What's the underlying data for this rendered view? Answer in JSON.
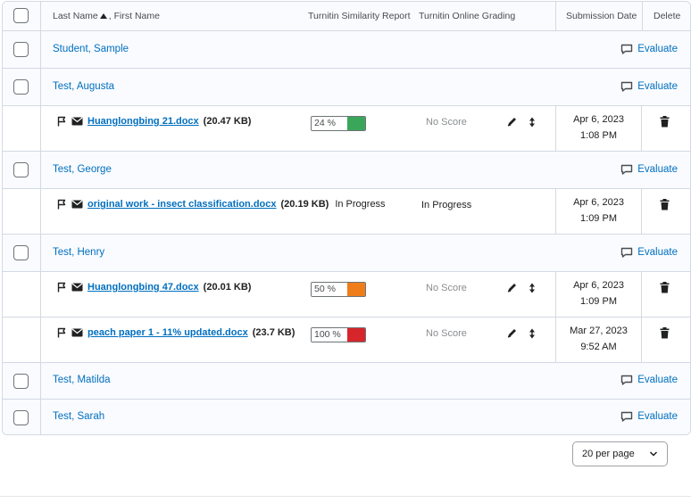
{
  "header": {
    "name_col": "Last Name",
    "name_col_suffix": ", First Name",
    "similarity_col": "Turnitin Similarity Report",
    "grading_col": "Turnitin Online Grading",
    "date_col": "Submission Date",
    "delete_col": "Delete"
  },
  "evaluate_label": "Evaluate",
  "no_score": "No Score",
  "students": [
    {
      "name": "Student, Sample"
    },
    {
      "name": "Test, Augusta"
    },
    {
      "name": "Test, George"
    },
    {
      "name": "Test, Henry"
    },
    {
      "name": "Test, Matilda"
    },
    {
      "name": "Test, Sarah"
    }
  ],
  "submissions": [
    {
      "file": "Huanglongbing 21.docx",
      "size": "(20.47 KB)",
      "similarity": "24 %",
      "sim_color": "#3aa65a",
      "grading": "No Score",
      "date": "Apr 6, 2023",
      "time": "1:08 PM"
    },
    {
      "file": "original work - insect classification.docx",
      "size": "(20.19 KB)",
      "status": "In Progress",
      "grading": "In Progress",
      "date": "Apr 6, 2023",
      "time": "1:09 PM"
    },
    {
      "file": "Huanglongbing 47.docx",
      "size": "(20.01 KB)",
      "similarity": "50 %",
      "sim_color": "#ef7d1a",
      "grading": "No Score",
      "date": "Apr 6, 2023",
      "time": "1:09 PM"
    },
    {
      "file": "peach paper 1 - 11% updated.docx",
      "size": "(23.7 KB)",
      "similarity": "100 %",
      "sim_color": "#d6262b",
      "grading": "No Score",
      "date": "Mar 27, 2023",
      "time": "9:52 AM"
    }
  ],
  "pager": {
    "per_page": "20 per page"
  }
}
